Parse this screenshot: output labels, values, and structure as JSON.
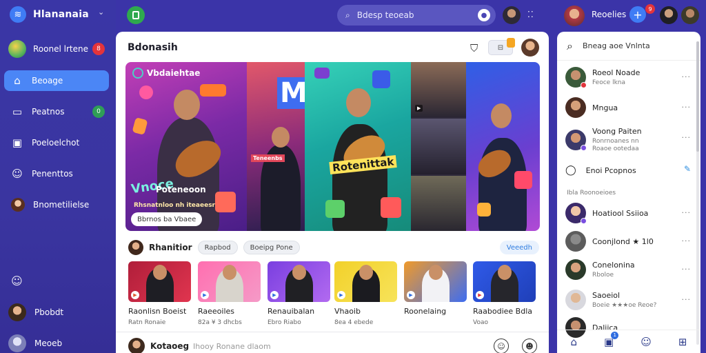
{
  "app": {
    "name": "Hlananaia"
  },
  "sidebar": {
    "profile": {
      "label": "Roonel lrtene",
      "badge": "8"
    },
    "items": [
      {
        "label": "Beoage",
        "icon": "home-icon"
      },
      {
        "label": "Peatnos",
        "icon": "monitor-icon",
        "badge": "0"
      },
      {
        "label": "Poeloelchot",
        "icon": "photos-icon"
      },
      {
        "label": "Penenttos",
        "icon": "people-icon"
      },
      {
        "label": "Bnometilielse",
        "icon": "avatar"
      }
    ],
    "bottom_users": [
      {
        "label": "Pbobdt"
      },
      {
        "label": "Meoeb"
      }
    ]
  },
  "topbar": {
    "search_placeholder": "Bdesp teoeab",
    "user_name": "Reoelies",
    "notif_badge": "9"
  },
  "main": {
    "title": "Bdonasih",
    "hero": {
      "badge": "Vbdaiehtae",
      "tag1": "Vnoce",
      "tag2": "Poteneoon",
      "tag3": "Rhsnatnloo nh iteaeesr",
      "cta": "Bbrnos ba Vbaee",
      "mid_title": "Rotenittak",
      "letter": "M",
      "small_tag": "Teneenbs"
    },
    "row": {
      "title": "Rhanitior",
      "chips": [
        "Rapbod",
        "Boeipg Pone"
      ],
      "view_all": "Veeedh"
    },
    "cards": [
      {
        "name": "Raonlisn Boeist",
        "meta": "Ratn Ronaie"
      },
      {
        "name": "Raeeoiles",
        "meta": "82a ¥ 3 dhcbs"
      },
      {
        "name": "Renauibalan",
        "meta": "Ebro Riabo"
      },
      {
        "name": "Vhaoib",
        "meta": "8ea 4 ebede"
      },
      {
        "name": "Roonelaing",
        "meta": ""
      },
      {
        "name": "Raabodiee Bdla",
        "meta": "Voao"
      }
    ],
    "composer": {
      "who": "Kotaoeg",
      "placeholder": "Ihooy Ronane dlaom"
    }
  },
  "right_panel": {
    "search_label": "Bneag aoe Vnlnta",
    "contacts": [
      {
        "name": "Roeol Noade",
        "sub": "Feoce lkna"
      },
      {
        "name": "Mngua",
        "sub": ""
      },
      {
        "name": "Voong Paiten",
        "sub": "Ronrnoanes nn\nRoaoe ootedaa"
      }
    ],
    "chat": {
      "label": "Enoi Pcopnos"
    },
    "section": "Ibla Roonoeioes",
    "suggestions": [
      {
        "name": "Hoatiool Ssiioa",
        "sub": ""
      },
      {
        "name": "Coonjlond ★ 1l0",
        "sub": ""
      },
      {
        "name": "Conelonina",
        "sub": "Rboloe"
      },
      {
        "name": "Saoeiol",
        "sub": "Boeie ★★★oe Reoe?"
      },
      {
        "name": "Daliica",
        "sub": ""
      }
    ]
  },
  "colors": {
    "accent": "#4b86f6",
    "sidebar": "#3a36a6",
    "badge": "#e4343b",
    "online": "#2f9e57"
  }
}
